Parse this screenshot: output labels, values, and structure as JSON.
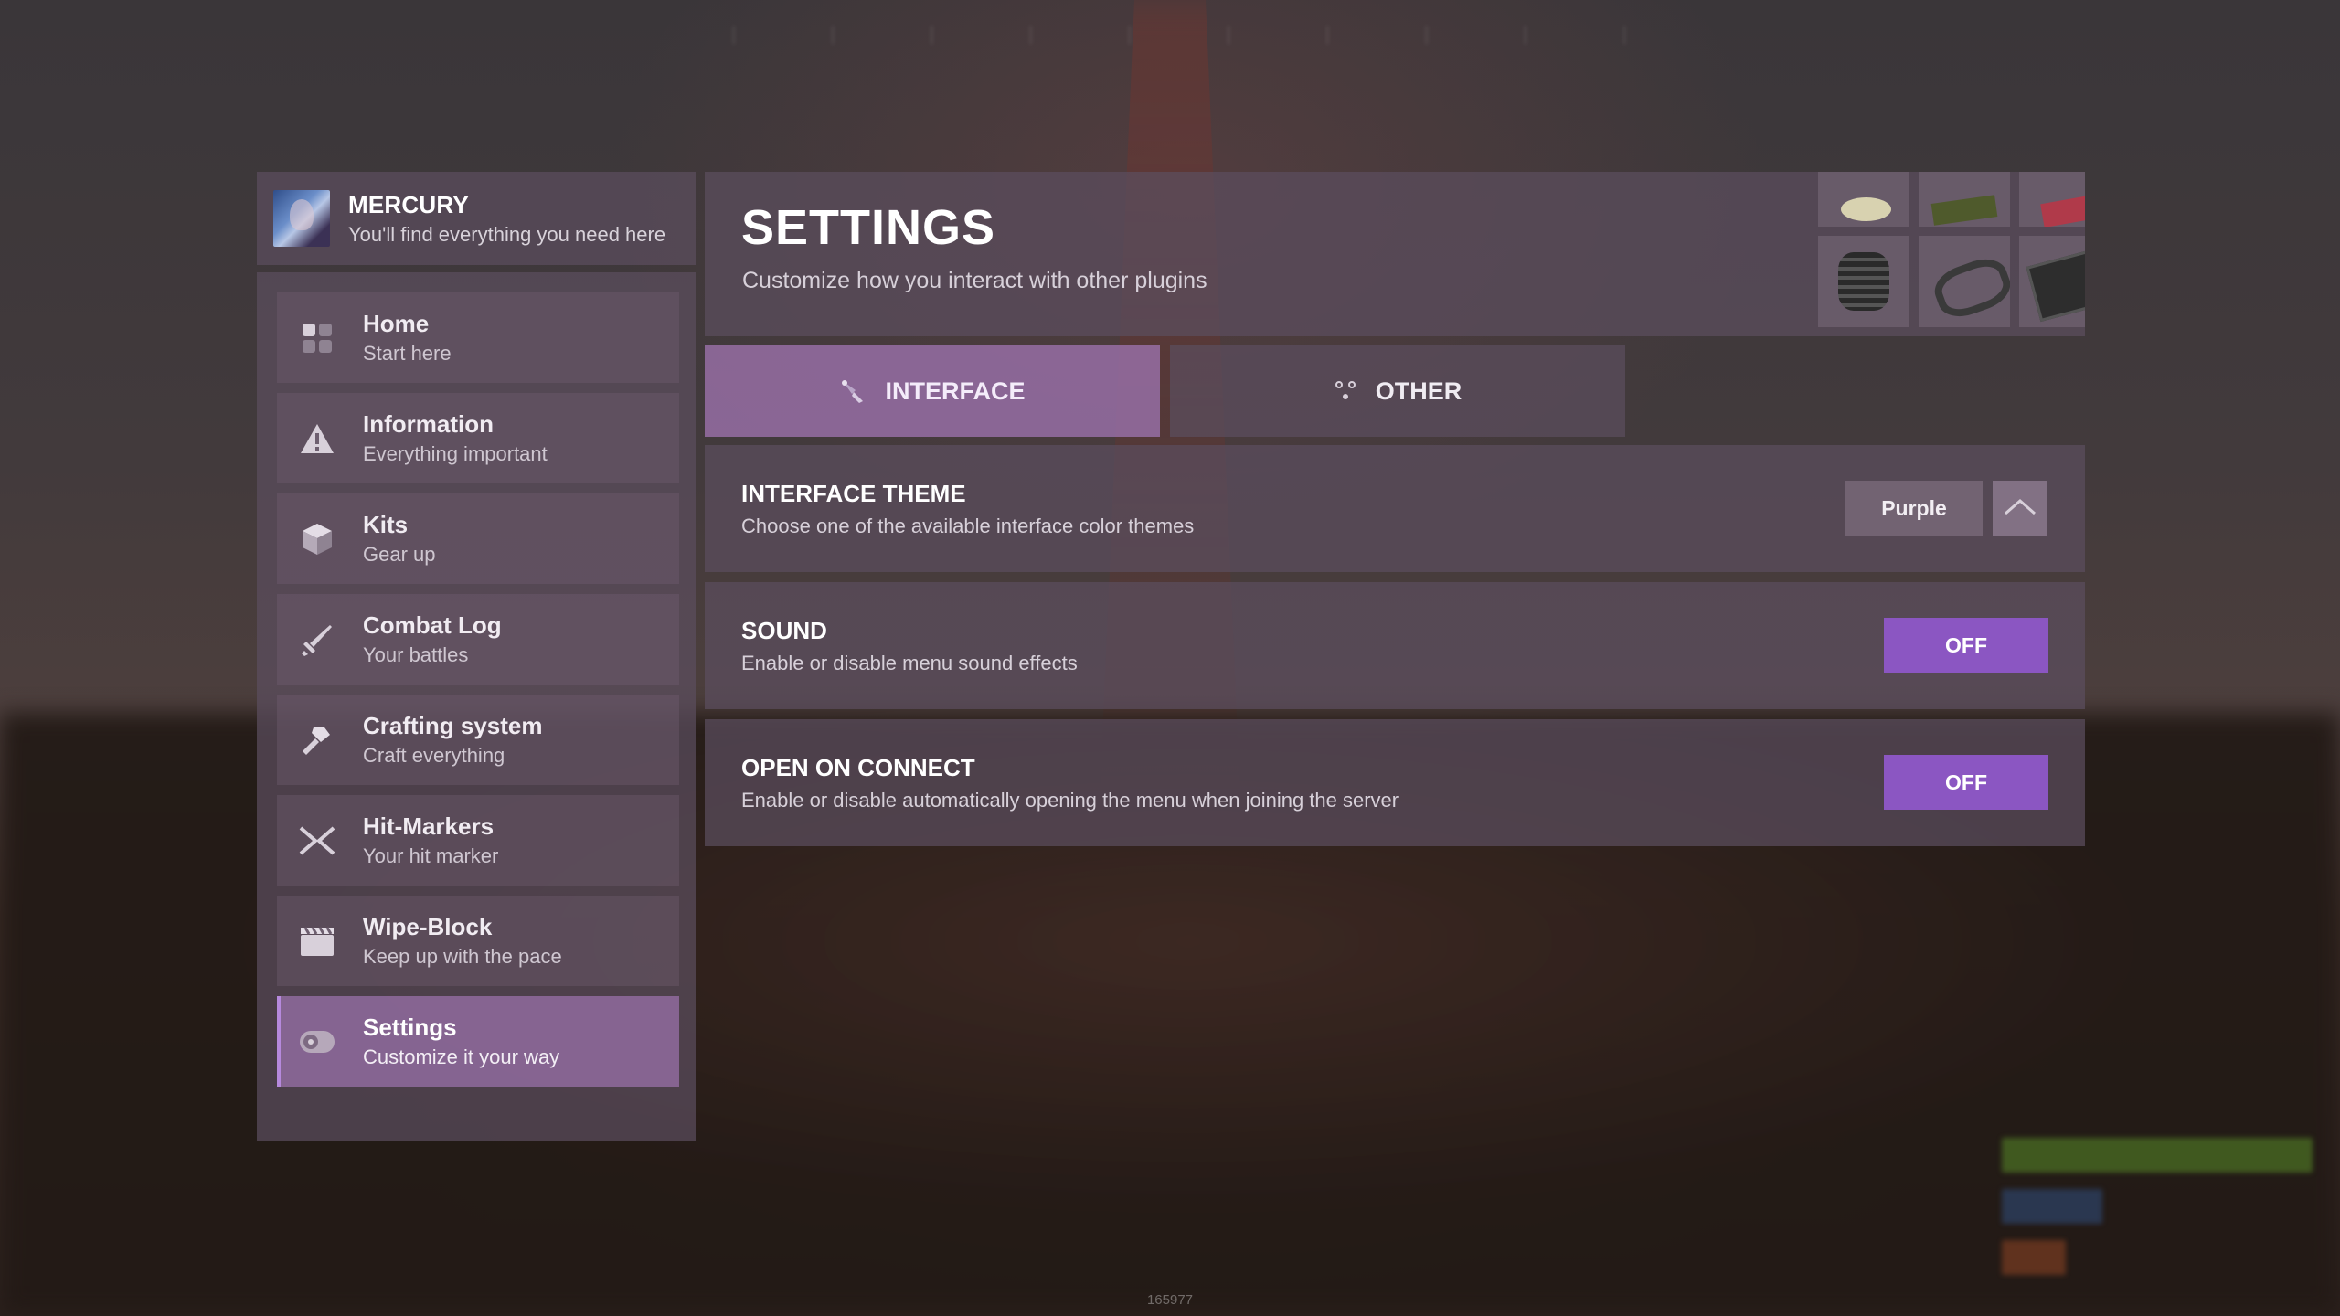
{
  "app": {
    "title": "MERCURY",
    "tagline": "You'll find everything you need here",
    "build_id": "165977"
  },
  "sidebar": {
    "items": [
      {
        "title": "Home",
        "subtitle": "Start here",
        "icon": "home-grid-icon"
      },
      {
        "title": "Information",
        "subtitle": "Everything important",
        "icon": "warning-icon"
      },
      {
        "title": "Kits",
        "subtitle": "Gear up",
        "icon": "box-icon"
      },
      {
        "title": "Combat Log",
        "subtitle": "Your battles",
        "icon": "sword-icon"
      },
      {
        "title": "Crafting system",
        "subtitle": "Craft everything",
        "icon": "hammer-icon"
      },
      {
        "title": "Hit-Markers",
        "subtitle": "Your hit marker",
        "icon": "crossed-swords-icon"
      },
      {
        "title": "Wipe-Block",
        "subtitle": "Keep up with the pace",
        "icon": "clapperboard-icon"
      },
      {
        "title": "Settings",
        "subtitle": "Customize it your way",
        "icon": "toggle-icon",
        "active": true
      }
    ]
  },
  "page": {
    "title": "SETTINGS",
    "subtitle": "Customize how you interact with other plugins"
  },
  "tabs": [
    {
      "label": "INTERFACE",
      "icon": "brush-icon",
      "active": true
    },
    {
      "label": "OTHER",
      "icon": "dots-icon",
      "active": false
    }
  ],
  "settings": {
    "theme": {
      "title": "INTERFACE THEME",
      "description": "Choose one of the available interface color themes",
      "value": "Purple"
    },
    "sound": {
      "title": "SOUND",
      "description": "Enable or disable menu sound effects",
      "value": "OFF"
    },
    "open_on_connect": {
      "title": "OPEN ON CONNECT",
      "description": "Enable or disable automatically opening the menu when joining the server",
      "value": "OFF"
    }
  },
  "colors": {
    "accent": "#8b56c2",
    "active_item": "#96a6a5",
    "panel": "#5c4e5e"
  }
}
